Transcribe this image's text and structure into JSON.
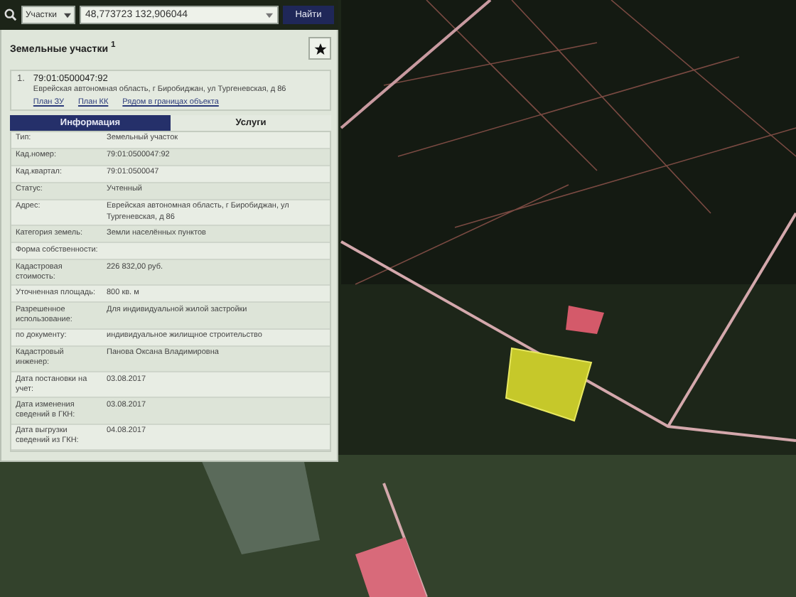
{
  "search": {
    "scope": "Участки",
    "value": "48,773723 132,906044",
    "button": "Найти"
  },
  "results": {
    "title": "Земельные участки",
    "count": "1",
    "item": {
      "index": "1.",
      "number": "79:01:0500047:92",
      "address": "Еврейская автономная область, г Биробиджан, ул Тургеневская, д 86",
      "links": [
        "План ЗУ",
        "План КК",
        "Рядом в границах объекта"
      ]
    }
  },
  "tabs": [
    {
      "label": "Информация",
      "selected": true
    },
    {
      "label": "Услуги",
      "selected": false
    }
  ],
  "fields": [
    {
      "label": "Тип:",
      "value": "Земельный участок"
    },
    {
      "label": "Кад.номер:",
      "value": "79:01:0500047:92"
    },
    {
      "label": "Кад.квартал:",
      "value": "79:01:0500047"
    },
    {
      "label": "Статус:",
      "value": "Учтенный"
    },
    {
      "label": "Адрес:",
      "value": "Еврейская автономная область, г Биробиджан, ул Тургеневская, д 86"
    },
    {
      "label": "Категория земель:",
      "value": "Земли населённых пунктов"
    },
    {
      "label": "Форма собственности:"
    },
    {
      "label": "Кадастровая стоимость:",
      "value": "226 832,00 руб."
    },
    {
      "label": "Уточненная площадь:",
      "value": "800 кв. м"
    },
    {
      "label": "Разрешенное использование:",
      "value": "Для индивидуальной жилой застройки"
    },
    {
      "label": "по документу:",
      "value": "индивидуальное жилищное строительство"
    },
    {
      "label": "Кадастровый инженер:",
      "value": "Панова Оксана Владимировна"
    },
    {
      "label": "Дата постановки на учет:",
      "value": "03.08.2017"
    },
    {
      "label": "Дата изменения сведений в ГКН:",
      "value": "03.08.2017"
    },
    {
      "label": "Дата выгрузки сведений из ГКН:",
      "value": "04.08.2017"
    }
  ]
}
